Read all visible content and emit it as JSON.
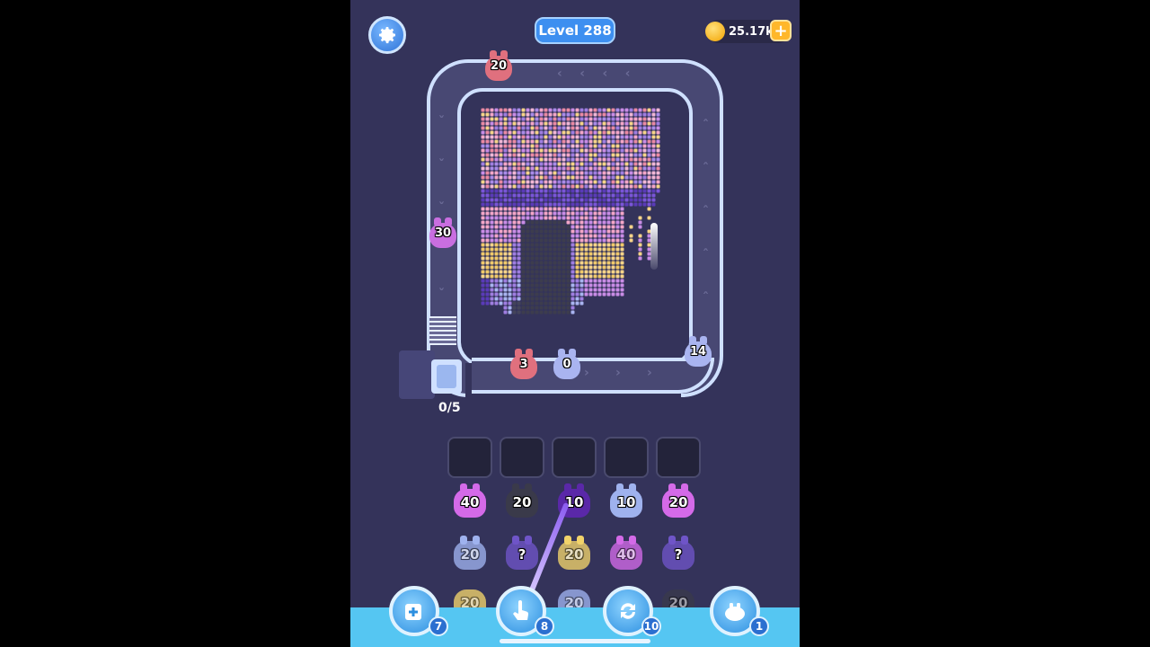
{
  "header": {
    "level": "Level 288",
    "coins": "25.17k",
    "coin_add": "+"
  },
  "track": {
    "collector_counter": "0/5",
    "pigs": [
      {
        "id": "top",
        "value": "20",
        "color": "#e0707e"
      },
      {
        "id": "left",
        "value": "30",
        "color": "#c96ee0"
      },
      {
        "id": "bottom-red",
        "value": "3",
        "color": "#e0707e"
      },
      {
        "id": "bottom-blue",
        "value": "0",
        "color": "#a9b4f0"
      },
      {
        "id": "right",
        "value": "14",
        "color": "#a9b4f0"
      }
    ]
  },
  "queue": {
    "row1": [
      {
        "value": "40",
        "color": "#d46ae8"
      },
      {
        "value": "20",
        "color": "#3a3a4a"
      },
      {
        "value": "10",
        "color": "#5a28a8"
      },
      {
        "value": "10",
        "color": "#9fb2ee"
      },
      {
        "value": "20",
        "color": "#d46ae8"
      }
    ],
    "row2": [
      {
        "value": "20",
        "color": "#9fb2ee"
      },
      {
        "value": "?",
        "color": "#6f55c8"
      },
      {
        "value": "20",
        "color": "#f2d36a"
      },
      {
        "value": "40",
        "color": "#d46ae8"
      },
      {
        "value": "?",
        "color": "#6f55c8"
      }
    ],
    "row3": [
      {
        "value": "20",
        "color": "#f2d36a"
      },
      {
        "value": "",
        "color": "#e0707e"
      },
      {
        "value": "20",
        "color": "#9fb2ee"
      },
      {
        "value": "",
        "color": "#9fb2ee"
      },
      {
        "value": "20",
        "color": "#3a3a4a"
      }
    ]
  },
  "boosters": [
    {
      "icon": "add-slot-icon",
      "count": "7"
    },
    {
      "icon": "tap-hand-icon",
      "count": "8"
    },
    {
      "icon": "shuffle-icon",
      "count": "10"
    },
    {
      "icon": "pig-icon",
      "count": "1"
    }
  ],
  "colors": {
    "background": "#34335a",
    "track": "#cfe0ff",
    "bottom_bar": "#55c6f2",
    "accent": "#3d8ff0"
  }
}
